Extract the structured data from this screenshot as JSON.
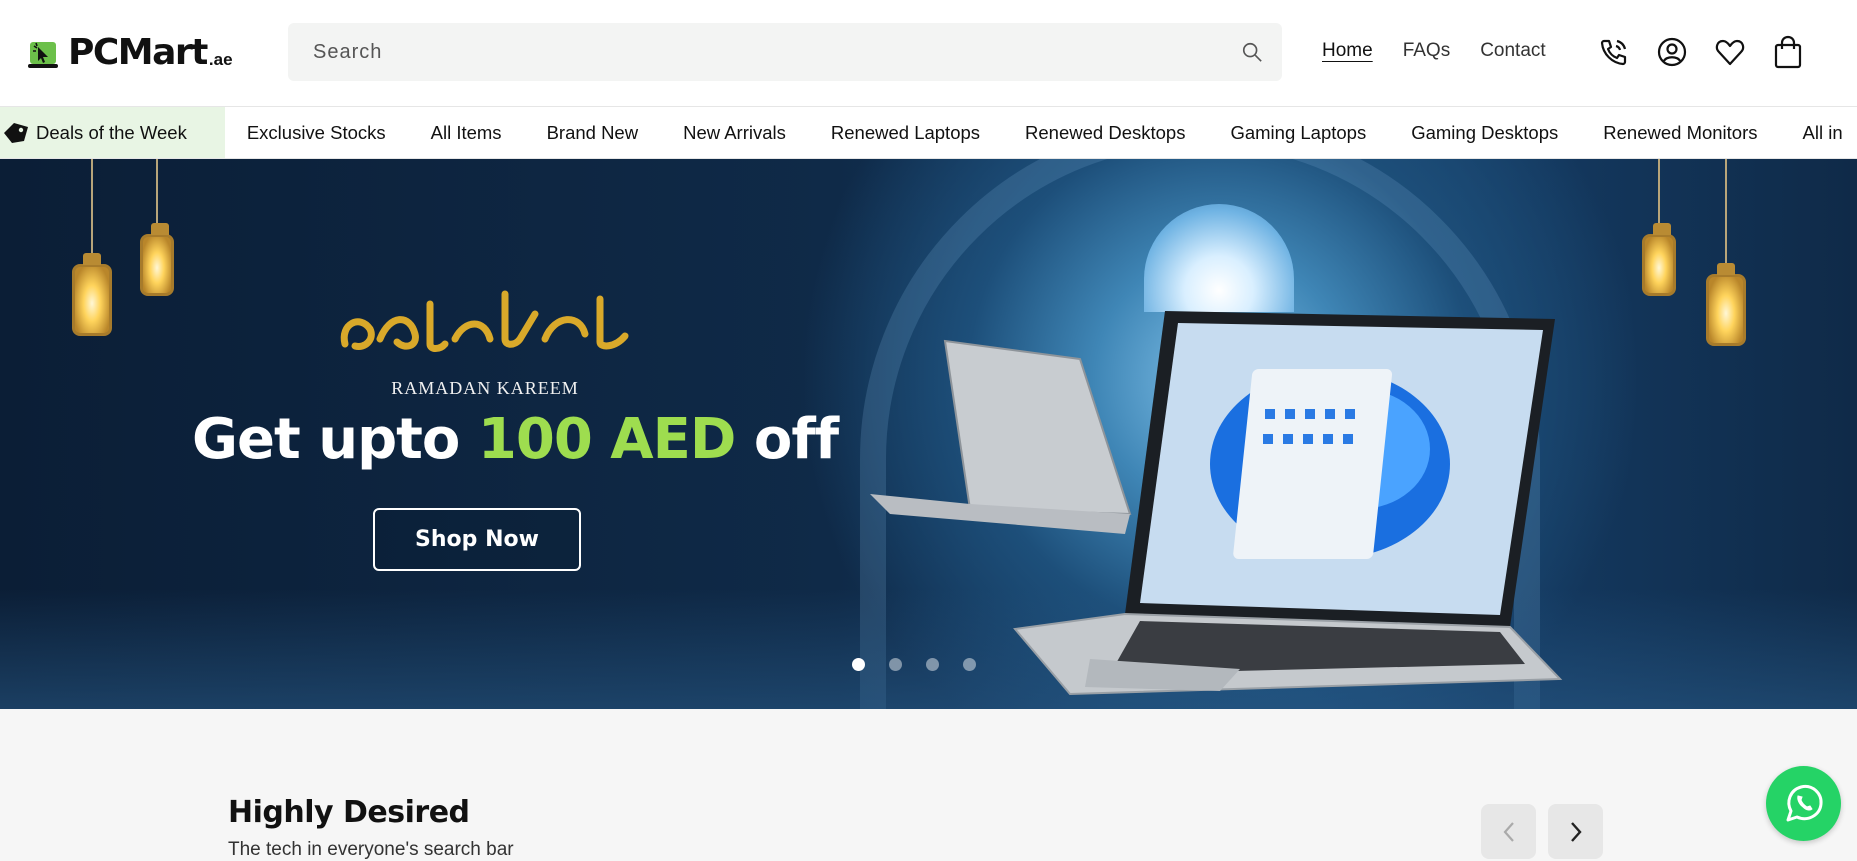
{
  "brand": {
    "name": "PCMart",
    "suffix": ".ae",
    "accent_color": "#6cc04a"
  },
  "search": {
    "placeholder": "Search",
    "icon": "search-icon"
  },
  "nav": {
    "links": [
      {
        "label": "Home",
        "active": true
      },
      {
        "label": "FAQs",
        "active": false
      },
      {
        "label": "Contact",
        "active": false
      }
    ]
  },
  "header_icons": [
    "phone-icon",
    "account-icon",
    "wishlist-heart-icon",
    "cart-bag-icon"
  ],
  "categories": {
    "deals_label": "Deals of the Week",
    "deals_bg": "#e8f5e4",
    "items": [
      "Exclusive Stocks",
      "All Items",
      "Brand New",
      "New Arrivals",
      "Renewed Laptops",
      "Renewed Desktops",
      "Gaming Laptops",
      "Gaming Desktops",
      "Renewed Monitors",
      "All in"
    ]
  },
  "hero": {
    "subtitle": "RAMADAN KAREEM",
    "headline_pre": "Get upto ",
    "headline_accent": "100 AED",
    "headline_post": " off",
    "accent_color": "#9edd4f",
    "cta_label": "Shop Now",
    "slides_total": 4,
    "active_slide": 1
  },
  "section": {
    "title": "Highly Desired",
    "subtitle": "The tech in everyone's search bar"
  },
  "floating": {
    "icon": "whatsapp-icon",
    "color": "#25d366"
  }
}
